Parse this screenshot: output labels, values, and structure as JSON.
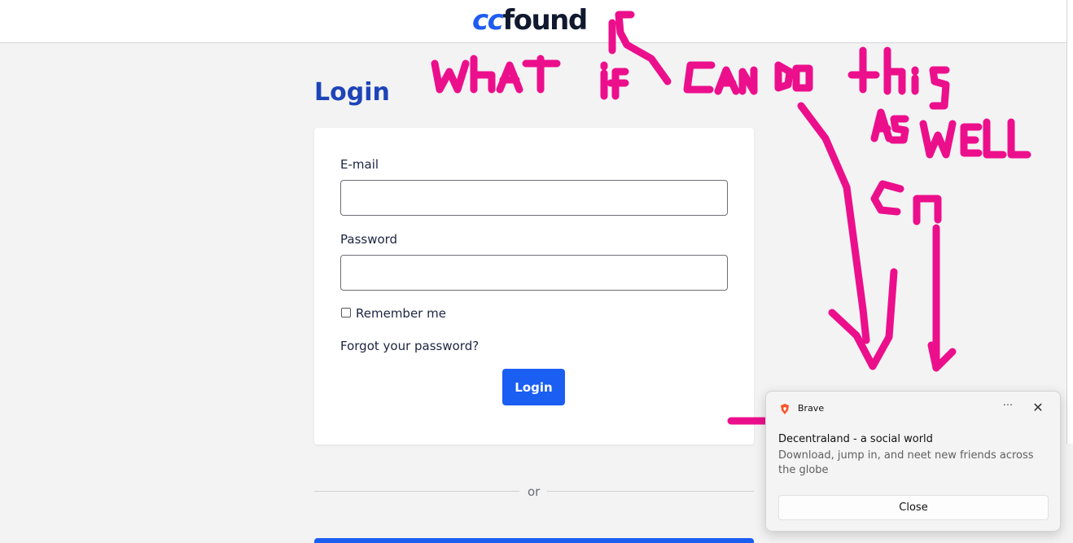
{
  "header": {
    "logo_prefix": "cc",
    "logo_suffix": "found"
  },
  "login": {
    "title": "Login",
    "email_label": "E-mail",
    "email_value": "",
    "password_label": "Password",
    "password_value": "",
    "remember_label": "Remember me",
    "remember_checked": false,
    "forgot_label": "Forgot your password?",
    "submit_label": "Login"
  },
  "divider": {
    "text": "or"
  },
  "notification": {
    "app_name": "Brave",
    "more_icon": "ellipsis-icon",
    "close_icon": "close-icon",
    "title": "Decentraland - a social world",
    "body": "Download, jump in, and neet new friends across the globe",
    "button_label": "Close"
  },
  "colors": {
    "brand_blue": "#1a5ef2",
    "title_blue": "#1e44b8",
    "annotation_pink": "#ec0f8c"
  }
}
